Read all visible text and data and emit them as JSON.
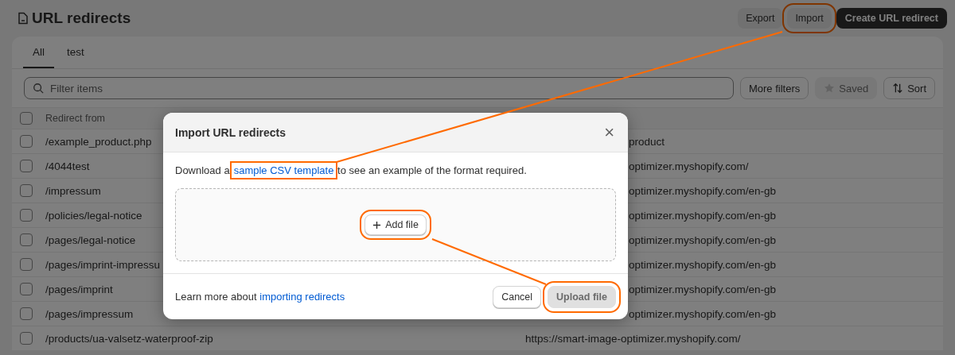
{
  "page": {
    "title": "URL redirects",
    "actions": [
      {
        "label": "Export",
        "kind": "secondary"
      },
      {
        "label": "Import",
        "kind": "secondary",
        "highlighted": true
      },
      {
        "label": "Create URL redirect",
        "kind": "primary"
      }
    ]
  },
  "tabs": [
    {
      "label": "All",
      "selected": true
    },
    {
      "label": "test",
      "selected": false
    }
  ],
  "filters": {
    "placeholder": "Filter items",
    "buttons": [
      {
        "label": "More filters",
        "disabled": false,
        "kind": "text"
      },
      {
        "label": "Saved",
        "disabled": true,
        "kind": "star"
      },
      {
        "label": "Sort",
        "disabled": false,
        "kind": "sort"
      }
    ]
  },
  "table": {
    "columns": [
      "Redirect from"
    ],
    "all_checked": false,
    "rows": [
      {
        "kind": "clipped",
        "from": "/example_product.php",
        "to": "product",
        "checked": false
      },
      {
        "kind": "clipped",
        "from": "/4044test",
        "to": "optimizer.myshopify.com/",
        "checked": false
      },
      {
        "kind": "clipped",
        "from": "/impressum",
        "to": "optimizer.myshopify.com/en-gb",
        "checked": false
      },
      {
        "kind": "clipped",
        "from": "/policies/legal-notice",
        "to": "optimizer.myshopify.com/en-gb",
        "checked": false
      },
      {
        "kind": "clipped",
        "from": "/pages/legal-notice",
        "to": "optimizer.myshopify.com/en-gb",
        "checked": false
      },
      {
        "kind": "clipped",
        "from": "/pages/imprint-impressu",
        "to": "optimizer.myshopify.com/en-gb",
        "checked": false
      },
      {
        "kind": "clipped",
        "from": "/pages/imprint",
        "to": "optimizer.myshopify.com/en-gb",
        "checked": false
      },
      {
        "kind": "clipped",
        "from": "/pages/impressum",
        "to": "optimizer.myshopify.com/en-gb",
        "checked": false
      },
      {
        "kind": "full",
        "from": "/products/ua-valsetz-waterproof-zip",
        "to": "https://smart-image-optimizer.myshopify.com/",
        "checked": false
      }
    ]
  },
  "dialog": {
    "title": "Import URL redirects",
    "close": "×",
    "intro_before": "Download a",
    "intro_link": "sample CSV template",
    "intro_link_highlighted": true,
    "intro_after": "to see an example of the format required.",
    "add_file": "Add file",
    "add_file_highlighted": true,
    "footer_text": "Learn more about",
    "footer_link": "importing redirects",
    "buttons": [
      {
        "label": "Cancel",
        "disabled": false,
        "kind": "secondary"
      },
      {
        "label": "Upload file",
        "disabled": true,
        "kind": "primary",
        "highlighted": true
      }
    ]
  }
}
